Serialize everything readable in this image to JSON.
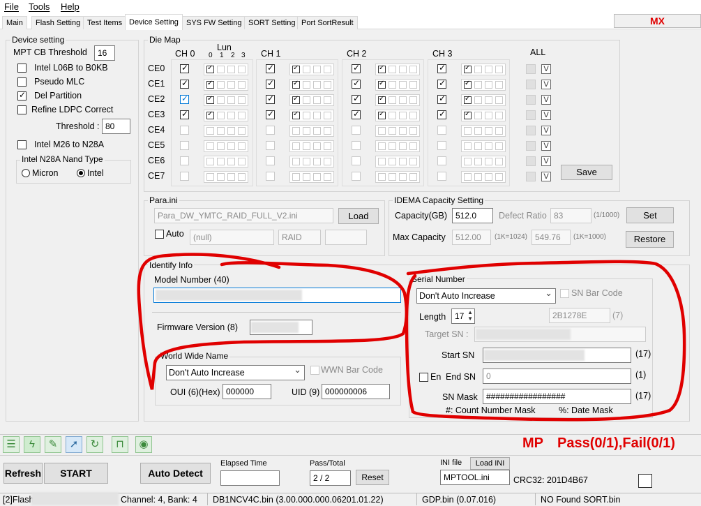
{
  "menu": {
    "file": "File",
    "tools": "Tools",
    "help": "Help"
  },
  "tabs": [
    "Main",
    "Flash Setting",
    "Test Items",
    "Device Setting",
    "SYS FW Setting",
    "SORT Setting",
    "Port SortResult"
  ],
  "brand": "MX",
  "device": {
    "title": "Device setting",
    "mpt_label": "MPT CB Threshold",
    "mpt_value": "16",
    "opt1": "Intel L06B to B0KB",
    "opt2": "Pseudo MLC",
    "opt3": "Del Partition",
    "opt4": "Refine LDPC Correct",
    "threshold_label": "Threshold :",
    "threshold_value": "80",
    "opt5": "Intel M26 to N28A",
    "nand_title": "Intel N28A Nand Type",
    "micron": "Micron",
    "intel": "Intel"
  },
  "diemap": {
    "title": "Die Map",
    "lun": "Lun",
    "lun_nums": [
      "0",
      "1",
      "2",
      "3"
    ],
    "ch": [
      "CH 0",
      "CH 1",
      "CH 2",
      "CH 3"
    ],
    "all": "ALL",
    "ce": [
      "CE0",
      "CE1",
      "CE2",
      "CE3",
      "CE4",
      "CE5",
      "CE6",
      "CE7"
    ],
    "v": "V",
    "save": "Save"
  },
  "para": {
    "title": "Para.ini",
    "file": "Para_DW_YMTC_RAID_FULL_V2.ini",
    "load": "Load",
    "auto": "Auto",
    "null": "(null)",
    "raid": "RAID"
  },
  "idema": {
    "title": "IDEMA Capacity Setting",
    "cap_label": "Capacity(GB)",
    "cap_value": "512.0",
    "defect_label": "Defect Ratio",
    "defect_value": "83",
    "defect_unit": "(1/1000)",
    "set": "Set",
    "max_label": "Max Capacity",
    "max1": "512.00",
    "max1_unit": "(1K=1024)",
    "max2": "549.76",
    "max2_unit": "(1K=1000)",
    "restore": "Restore"
  },
  "identify": {
    "title": "Identify Info",
    "model": "Model Number (40)",
    "fw": "Firmware Version (8)"
  },
  "wwn": {
    "title": "World Wide Name",
    "mode": "Don't Auto Increase",
    "barcode": "WWN Bar Code",
    "oui_label": "OUI (6)(Hex)",
    "oui": "000000",
    "uid_label": "UID (9)",
    "uid": "000000006"
  },
  "serial": {
    "title": "Serial Number",
    "mode": "Don't Auto Increase",
    "barcode": "SN Bar Code",
    "length_label": "Length",
    "length": "17",
    "sn_value": "2B1278E",
    "sn_count": "(7)",
    "target_label": "Target SN :",
    "start_label": "Start SN",
    "start_count": "(17)",
    "en_label": "En",
    "end_label": "End SN",
    "end_value": "0",
    "end_count": "(1)",
    "mask_label": "SN Mask",
    "mask_value": "#################",
    "mask_count": "(17)",
    "hint1": "#: Count Number Mask",
    "hint2": "%: Date Mask"
  },
  "mp": {
    "label": "MP",
    "pass_fail": "Pass(0/1),Fail(0/1)"
  },
  "controls": {
    "refresh": "Refresh",
    "start": "START",
    "auto_detect": "Auto Detect",
    "elapsed_label": "Elapsed Time",
    "pass_total_label": "Pass/Total",
    "pass_total": "2 / 2",
    "reset": "Reset",
    "ini_label": "INI file",
    "load_ini": "Load INI",
    "ini_file": "MPTOOL.ini",
    "crc": "CRC32: 201D4B67"
  },
  "status": {
    "port": "[2]Flash",
    "channel": "Channel: 4, Bank: 4",
    "fw": "DB1NCV4C.bin (3.00.000.000.06201.01.22)",
    "gdp": "GDP.bin (0.07.016)",
    "sort": "NO Found SORT.bin"
  }
}
